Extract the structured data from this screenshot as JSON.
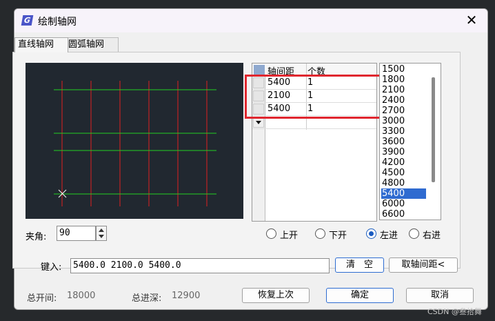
{
  "window": {
    "title": "绘制轴网",
    "app_icon": "G",
    "close_glyph": "✕"
  },
  "tabs": [
    {
      "label": "直线轴网"
    },
    {
      "label": "圆弧轴网"
    }
  ],
  "table": {
    "headers": [
      "轴间距",
      "个数"
    ],
    "rows": [
      {
        "spacing": "5400",
        "count": "1"
      },
      {
        "spacing": "2100",
        "count": "1"
      },
      {
        "spacing": "5400",
        "count": "1"
      }
    ]
  },
  "value_list": {
    "items": [
      "1500",
      "1800",
      "2100",
      "2400",
      "2700",
      "3000",
      "3300",
      "3600",
      "3900",
      "4200",
      "4500",
      "4800",
      "5400",
      "6000",
      "6600"
    ],
    "selected": "5400"
  },
  "angle": {
    "label": "夹角:",
    "value": "90"
  },
  "direction": {
    "options": [
      "上开",
      "下开",
      "左进",
      "右进"
    ],
    "selected": "左进"
  },
  "input": {
    "label": "键入:",
    "value": "5400.0 2100.0 5400.0"
  },
  "buttons": {
    "clear": "清　空",
    "pick_spacing": "取轴间距<",
    "restore": "恢复上次",
    "ok": "确定",
    "cancel": "取消"
  },
  "summary": {
    "total_width_label": "总开间:",
    "total_width_value": "18000",
    "total_depth_label": "总进深:",
    "total_depth_value": "12900"
  },
  "colors": {
    "axis_vertical": "#e02020",
    "axis_horizontal": "#22d022",
    "preview_bg": "#212830",
    "highlight": "#e0262e"
  },
  "watermark": "CSDN @叁拾舞"
}
